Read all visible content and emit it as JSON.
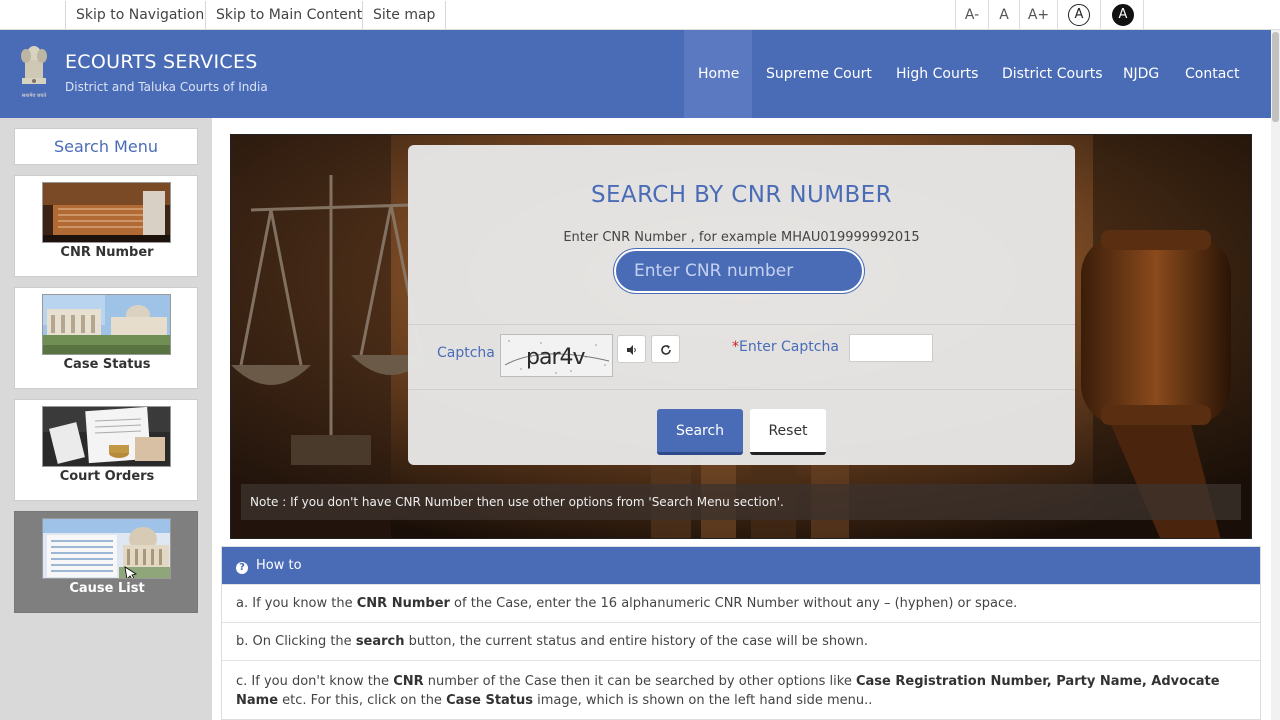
{
  "topbar": {
    "skip_nav": "Skip to Navigation",
    "skip_main": "Skip to Main Content",
    "site_map": "Site map",
    "font_small": "A-",
    "font_normal": "A",
    "font_large": "A+",
    "contrast_light": "A",
    "contrast_dark": "A"
  },
  "header": {
    "title": "ECOURTS SERVICES",
    "subtitle": "District and Taluka Courts of India",
    "emblem_caption": "सत्यमेव जयते",
    "nav": [
      "Home",
      "Supreme Court",
      "High Courts",
      "District Courts",
      "NJDG",
      "Contact Us"
    ],
    "active_nav": "Home"
  },
  "sidebar": {
    "heading": "Search Menu",
    "items": [
      {
        "label": "CNR Number",
        "active": false
      },
      {
        "label": "Case Status",
        "active": false
      },
      {
        "label": "Court Orders",
        "active": false
      },
      {
        "label": "Cause List",
        "active": true
      }
    ]
  },
  "search_panel": {
    "title": "SEARCH BY CNR NUMBER",
    "hint": "Enter CNR Number , for example MHAU019999992015",
    "cnr_placeholder": "Enter CNR number",
    "captcha_label": "Captcha",
    "captcha_text": "par4v",
    "enter_captcha_required": "*",
    "enter_captcha_label": "Enter Captcha",
    "search_label": "Search",
    "reset_label": "Reset"
  },
  "note": "Note : If you don't have CNR Number then use other options from 'Search Menu section'.",
  "howto": {
    "heading": "How to",
    "a": {
      "p1": "a. If you know the ",
      "b1": "CNR Number",
      "p2": " of the Case, enter the 16 alphanumeric CNR Number without any – (hyphen) or space."
    },
    "b": {
      "p1": "b. On Clicking the ",
      "b1": "search",
      "p2": " button, the current status and entire history of the case will be shown."
    },
    "c": {
      "p1": "c. If you don't know the ",
      "b1": "CNR",
      "p2": " number of the Case then it can be searched by other options like ",
      "b2": "Case Registration Number, Party Name, Advocate Name",
      "p3": " etc. For this, click on the ",
      "b3": "Case Status",
      "p4": " image, which is shown on the left hand side menu.."
    }
  },
  "colors": {
    "brand_blue": "#4a6cb6",
    "required_red": "#cc2222"
  }
}
